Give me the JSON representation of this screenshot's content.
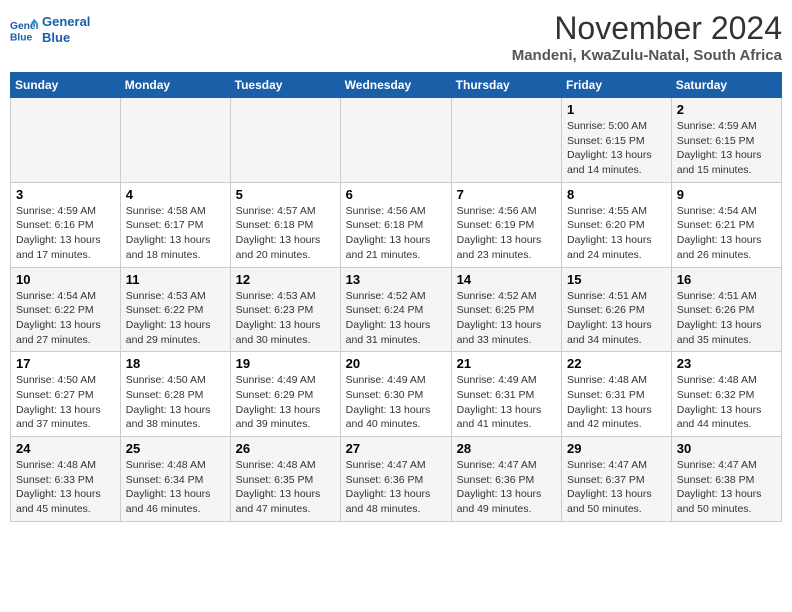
{
  "logo": {
    "line1": "General",
    "line2": "Blue"
  },
  "title": "November 2024",
  "subtitle": "Mandeni, KwaZulu-Natal, South Africa",
  "days_of_week": [
    "Sunday",
    "Monday",
    "Tuesday",
    "Wednesday",
    "Thursday",
    "Friday",
    "Saturday"
  ],
  "weeks": [
    [
      {
        "day": "",
        "detail": ""
      },
      {
        "day": "",
        "detail": ""
      },
      {
        "day": "",
        "detail": ""
      },
      {
        "day": "",
        "detail": ""
      },
      {
        "day": "",
        "detail": ""
      },
      {
        "day": "1",
        "detail": "Sunrise: 5:00 AM\nSunset: 6:15 PM\nDaylight: 13 hours\nand 14 minutes."
      },
      {
        "day": "2",
        "detail": "Sunrise: 4:59 AM\nSunset: 6:15 PM\nDaylight: 13 hours\nand 15 minutes."
      }
    ],
    [
      {
        "day": "3",
        "detail": "Sunrise: 4:59 AM\nSunset: 6:16 PM\nDaylight: 13 hours\nand 17 minutes."
      },
      {
        "day": "4",
        "detail": "Sunrise: 4:58 AM\nSunset: 6:17 PM\nDaylight: 13 hours\nand 18 minutes."
      },
      {
        "day": "5",
        "detail": "Sunrise: 4:57 AM\nSunset: 6:18 PM\nDaylight: 13 hours\nand 20 minutes."
      },
      {
        "day": "6",
        "detail": "Sunrise: 4:56 AM\nSunset: 6:18 PM\nDaylight: 13 hours\nand 21 minutes."
      },
      {
        "day": "7",
        "detail": "Sunrise: 4:56 AM\nSunset: 6:19 PM\nDaylight: 13 hours\nand 23 minutes."
      },
      {
        "day": "8",
        "detail": "Sunrise: 4:55 AM\nSunset: 6:20 PM\nDaylight: 13 hours\nand 24 minutes."
      },
      {
        "day": "9",
        "detail": "Sunrise: 4:54 AM\nSunset: 6:21 PM\nDaylight: 13 hours\nand 26 minutes."
      }
    ],
    [
      {
        "day": "10",
        "detail": "Sunrise: 4:54 AM\nSunset: 6:22 PM\nDaylight: 13 hours\nand 27 minutes."
      },
      {
        "day": "11",
        "detail": "Sunrise: 4:53 AM\nSunset: 6:22 PM\nDaylight: 13 hours\nand 29 minutes."
      },
      {
        "day": "12",
        "detail": "Sunrise: 4:53 AM\nSunset: 6:23 PM\nDaylight: 13 hours\nand 30 minutes."
      },
      {
        "day": "13",
        "detail": "Sunrise: 4:52 AM\nSunset: 6:24 PM\nDaylight: 13 hours\nand 31 minutes."
      },
      {
        "day": "14",
        "detail": "Sunrise: 4:52 AM\nSunset: 6:25 PM\nDaylight: 13 hours\nand 33 minutes."
      },
      {
        "day": "15",
        "detail": "Sunrise: 4:51 AM\nSunset: 6:26 PM\nDaylight: 13 hours\nand 34 minutes."
      },
      {
        "day": "16",
        "detail": "Sunrise: 4:51 AM\nSunset: 6:26 PM\nDaylight: 13 hours\nand 35 minutes."
      }
    ],
    [
      {
        "day": "17",
        "detail": "Sunrise: 4:50 AM\nSunset: 6:27 PM\nDaylight: 13 hours\nand 37 minutes."
      },
      {
        "day": "18",
        "detail": "Sunrise: 4:50 AM\nSunset: 6:28 PM\nDaylight: 13 hours\nand 38 minutes."
      },
      {
        "day": "19",
        "detail": "Sunrise: 4:49 AM\nSunset: 6:29 PM\nDaylight: 13 hours\nand 39 minutes."
      },
      {
        "day": "20",
        "detail": "Sunrise: 4:49 AM\nSunset: 6:30 PM\nDaylight: 13 hours\nand 40 minutes."
      },
      {
        "day": "21",
        "detail": "Sunrise: 4:49 AM\nSunset: 6:31 PM\nDaylight: 13 hours\nand 41 minutes."
      },
      {
        "day": "22",
        "detail": "Sunrise: 4:48 AM\nSunset: 6:31 PM\nDaylight: 13 hours\nand 42 minutes."
      },
      {
        "day": "23",
        "detail": "Sunrise: 4:48 AM\nSunset: 6:32 PM\nDaylight: 13 hours\nand 44 minutes."
      }
    ],
    [
      {
        "day": "24",
        "detail": "Sunrise: 4:48 AM\nSunset: 6:33 PM\nDaylight: 13 hours\nand 45 minutes."
      },
      {
        "day": "25",
        "detail": "Sunrise: 4:48 AM\nSunset: 6:34 PM\nDaylight: 13 hours\nand 46 minutes."
      },
      {
        "day": "26",
        "detail": "Sunrise: 4:48 AM\nSunset: 6:35 PM\nDaylight: 13 hours\nand 47 minutes."
      },
      {
        "day": "27",
        "detail": "Sunrise: 4:47 AM\nSunset: 6:36 PM\nDaylight: 13 hours\nand 48 minutes."
      },
      {
        "day": "28",
        "detail": "Sunrise: 4:47 AM\nSunset: 6:36 PM\nDaylight: 13 hours\nand 49 minutes."
      },
      {
        "day": "29",
        "detail": "Sunrise: 4:47 AM\nSunset: 6:37 PM\nDaylight: 13 hours\nand 50 minutes."
      },
      {
        "day": "30",
        "detail": "Sunrise: 4:47 AM\nSunset: 6:38 PM\nDaylight: 13 hours\nand 50 minutes."
      }
    ]
  ]
}
